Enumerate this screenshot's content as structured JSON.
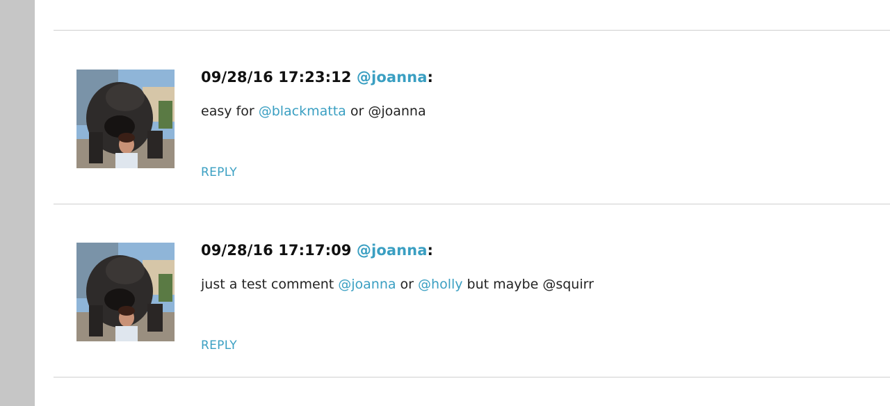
{
  "comments": [
    {
      "timestamp": "09/28/16 17:23:12",
      "author": "@joanna",
      "author_suffix": ":",
      "text": {
        "part1": "easy for ",
        "mention1": "@blackmatta",
        "part2": " or @joanna"
      },
      "reply_label": "REPLY"
    },
    {
      "timestamp": "09/28/16 17:17:09",
      "author": "@joanna",
      "author_suffix": ":",
      "text": {
        "part1": "just a test comment ",
        "mention1": "@joanna",
        "part2": " or ",
        "mention2": "@holly",
        "part3": " but maybe @squirr"
      },
      "reply_label": "REPLY"
    }
  ],
  "colors": {
    "link": "#3a9fc2",
    "sidebar": "#c6c6c6",
    "divider": "#cfcfcf"
  }
}
